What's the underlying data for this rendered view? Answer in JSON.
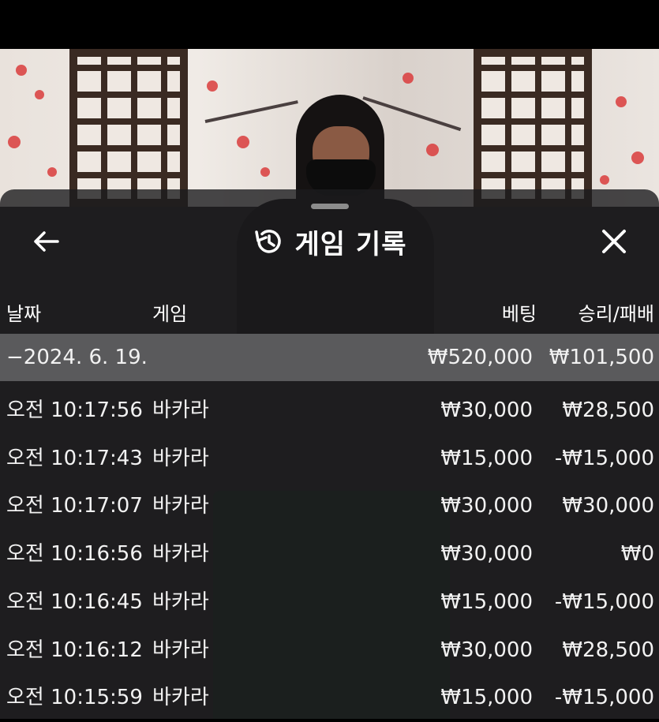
{
  "sheet": {
    "title": "게임 기록",
    "back_icon": "arrow-left-icon",
    "history_icon": "history-icon",
    "close_icon": "close-icon"
  },
  "table": {
    "headers": {
      "date": "날짜",
      "game": "게임",
      "bet": "베팅",
      "result": "승리/패배"
    },
    "summary": {
      "date": "−2024. 6. 19.",
      "bet": "₩520,000",
      "result": "₩101,500"
    },
    "rows": [
      {
        "time": "오전 10:17:56",
        "game": "바카라",
        "bet": "₩30,000",
        "result": "₩28,500"
      },
      {
        "time": "오전 10:17:43",
        "game": "바카라",
        "bet": "₩15,000",
        "result": "-₩15,000"
      },
      {
        "time": "오전 10:17:07",
        "game": "바카라",
        "bet": "₩30,000",
        "result": "₩30,000"
      },
      {
        "time": "오전 10:16:56",
        "game": "바카라",
        "bet": "₩30,000",
        "result": "₩0"
      },
      {
        "time": "오전 10:16:45",
        "game": "바카라",
        "bet": "₩15,000",
        "result": "-₩15,000"
      },
      {
        "time": "오전 10:16:12",
        "game": "바카라",
        "bet": "₩30,000",
        "result": "₩28,500"
      },
      {
        "time": "오전 10:15:59",
        "game": "바카라",
        "bet": "₩15,000",
        "result": "-₩15,000"
      }
    ]
  },
  "colors": {
    "sheet_bg": "#1c1c1e",
    "summary_bg": "#5a5a5c",
    "text": "#ffffff"
  }
}
